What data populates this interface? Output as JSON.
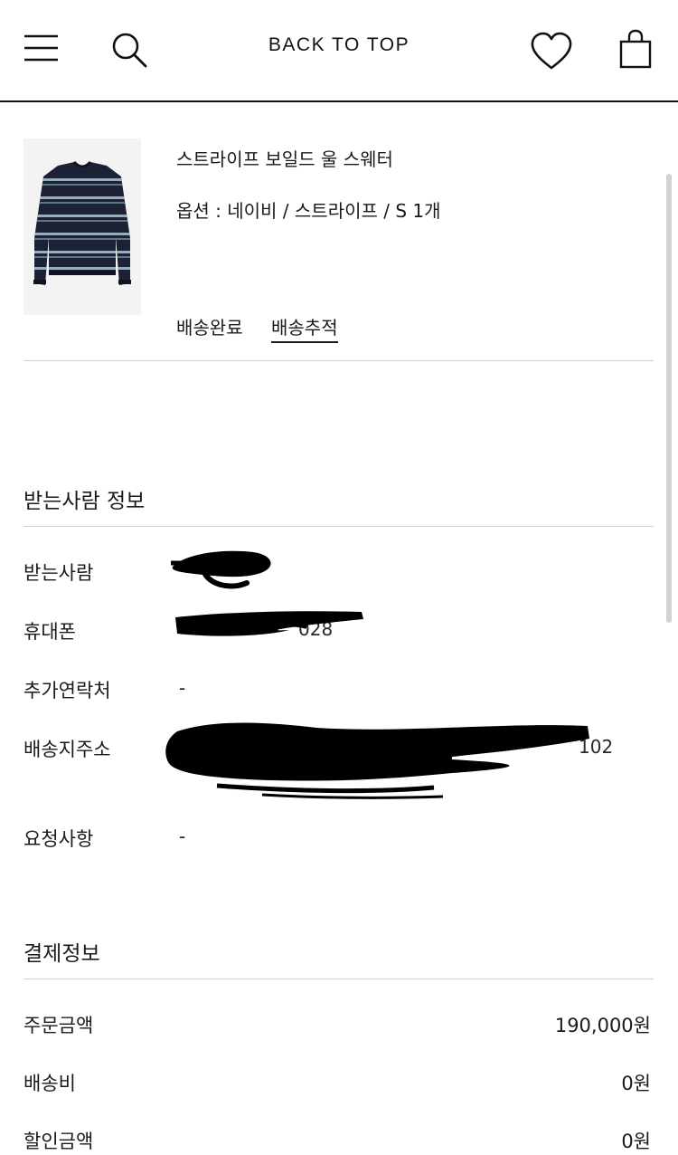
{
  "header": {
    "back_to_top": "BACK TO TOP",
    "icons": [
      "menu-icon",
      "search-icon",
      "heart-icon",
      "bag-icon"
    ]
  },
  "product": {
    "name": "스트라이프 보일드 울 스웨터",
    "option": "옵션 : 네이비 / 스트라이프 / S 1개",
    "status": "배송완료",
    "track_label": "배송추적"
  },
  "recipient": {
    "title": "받는사람 정보",
    "rows": [
      {
        "label": "받는사람",
        "value": ""
      },
      {
        "label": "휴대폰",
        "value": "",
        "visible_fragment": "028"
      },
      {
        "label": "추가연락처",
        "value": "-"
      },
      {
        "label": "배송지주소",
        "value": "",
        "visible_fragment": "102"
      },
      {
        "label": "요청사항",
        "value": "-"
      }
    ]
  },
  "payment": {
    "title": "결제정보",
    "rows": [
      {
        "label": "주문금액",
        "value": "190,000원"
      },
      {
        "label": "배송비",
        "value": "0원"
      },
      {
        "label": "할인금액",
        "value": "0원"
      }
    ]
  },
  "colors": {
    "text": "#1a1a1a",
    "divider": "#cfcfcf",
    "sweater_navy": "#1c2233",
    "stripe_light": "#8fb0c0",
    "redaction": "#000000"
  }
}
